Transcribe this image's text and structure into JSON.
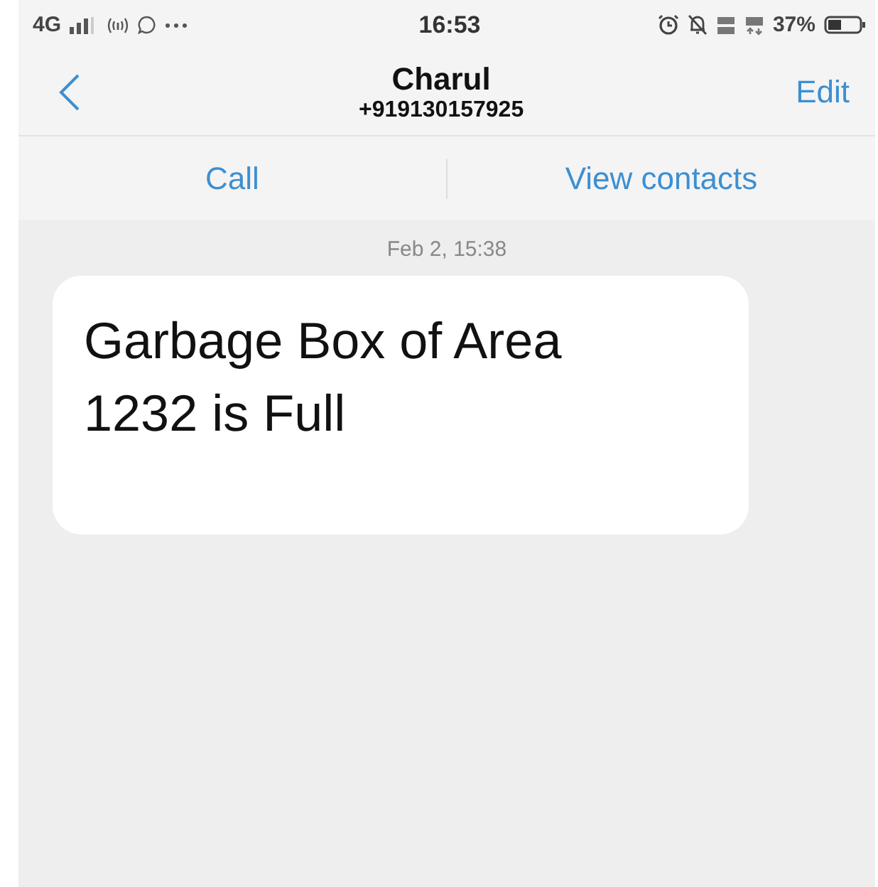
{
  "status_bar": {
    "network": "4G",
    "time": "16:53",
    "battery": "37%"
  },
  "header": {
    "name": "Charul",
    "number": "+919130157925",
    "edit": "Edit"
  },
  "actions": [
    "Call",
    "View contacts"
  ],
  "messages": [
    {
      "timestamp": "Feb 2, 15:38",
      "text": "Garbage Box of Area 1232 is Full"
    }
  ]
}
